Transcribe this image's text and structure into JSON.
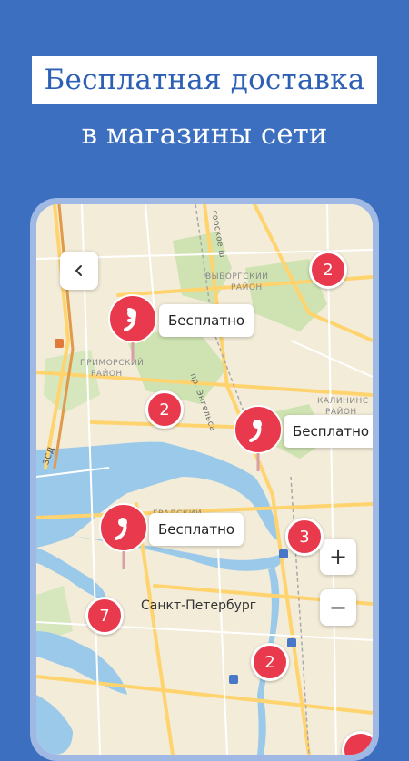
{
  "headline": "Бесплатная доставка",
  "subheadline": "в магазины сети",
  "map": {
    "back_icon": "chevron-left-icon",
    "zoom_in": "+",
    "zoom_out": "−",
    "city_label": "Санкт-Петербург",
    "district_labels": {
      "vyborgsky_1": "ВЫБОРГСКИЙ",
      "vyborgsky_2": "РАЙОН",
      "primorsky_1": "ПРИМОРСКИЙ",
      "primorsky_2": "РАЙОН",
      "kalininsky": "КАЛИНИНС",
      "kalininsky_2": "РАЙОН",
      "petrogradsky": "ГРАДСКИЙ",
      "road_engelsa": "пр. Энгельса",
      "road_sh": "горское ш",
      "road_zsd": "ЗСД"
    },
    "free_label": "Бесплатно",
    "clusters": [
      "2",
      "2",
      "3",
      "7",
      "2"
    ],
    "colors": {
      "accent": "#e8394d",
      "background": "#3d6fc0"
    }
  }
}
